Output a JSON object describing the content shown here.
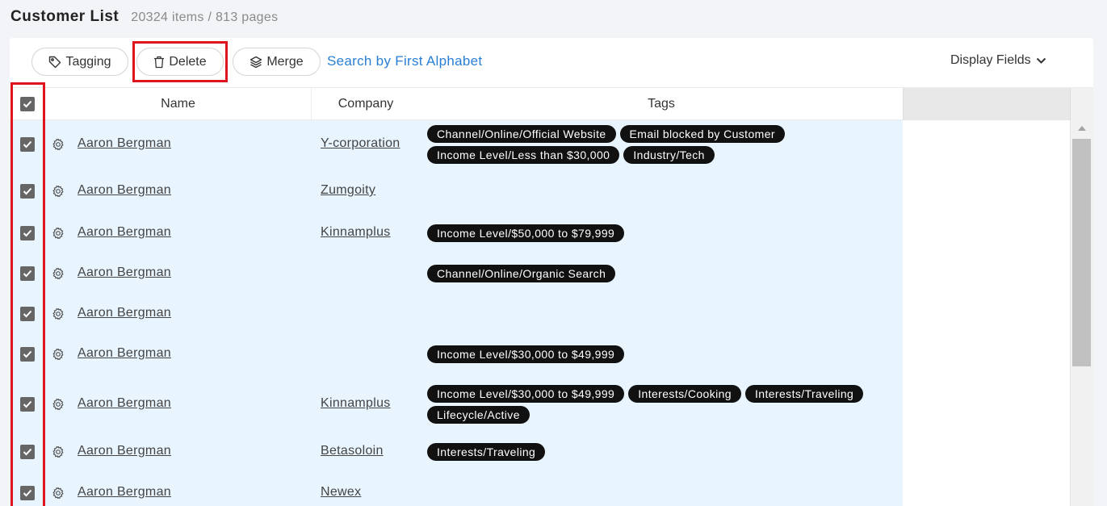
{
  "header": {
    "title": "Customer List",
    "count": "20324 items / 813 pages"
  },
  "toolbar": {
    "tagging_label": "Tagging",
    "delete_label": "Delete",
    "merge_label": "Merge",
    "search_alpha_label": "Search by First Alphabet",
    "display_fields_label": "Display Fields"
  },
  "columns": {
    "name": "Name",
    "company": "Company",
    "tags": "Tags"
  },
  "rows": [
    {
      "name": "Aaron Bergman",
      "company": "Y-corporation",
      "tags": [
        "Channel/Online/Official Website",
        "Email blocked by Customer",
        "Income Level/Less than $30,000",
        "Industry/Tech"
      ],
      "checked": true
    },
    {
      "name": "Aaron Bergman",
      "company": "Zumgoity",
      "tags": [],
      "checked": true
    },
    {
      "name": "Aaron Bergman",
      "company": "Kinnamplus",
      "tags": [
        "Income Level/$50,000 to $79,999"
      ],
      "checked": true
    },
    {
      "name": "Aaron Bergman",
      "company": "",
      "tags": [
        "Channel/Online/Organic Search"
      ],
      "checked": true
    },
    {
      "name": "Aaron Bergman",
      "company": "",
      "tags": [],
      "checked": true
    },
    {
      "name": "Aaron Bergman",
      "company": "",
      "tags": [
        "Income Level/$30,000 to $49,999"
      ],
      "checked": true
    },
    {
      "name": "Aaron Bergman",
      "company": "Kinnamplus",
      "tags": [
        "Income Level/$30,000 to $49,999",
        "Interests/Cooking",
        "Interests/Traveling",
        "Lifecycle/Active"
      ],
      "checked": true
    },
    {
      "name": "Aaron Bergman",
      "company": "Betasoloin",
      "tags": [
        "Interests/Traveling"
      ],
      "checked": true
    },
    {
      "name": "Aaron Bergman",
      "company": "Newex",
      "tags": [],
      "checked": true
    }
  ],
  "colors": {
    "highlight": "#e0141e",
    "link": "#2a7fd4",
    "row_bg": "#e8f4fe",
    "tag_bg": "#111111"
  },
  "icons": {
    "tagging": "tag-icon",
    "delete": "trash-icon",
    "merge": "layers-icon",
    "display_fields": "chevron-down-icon",
    "row_settings": "gear-icon"
  }
}
